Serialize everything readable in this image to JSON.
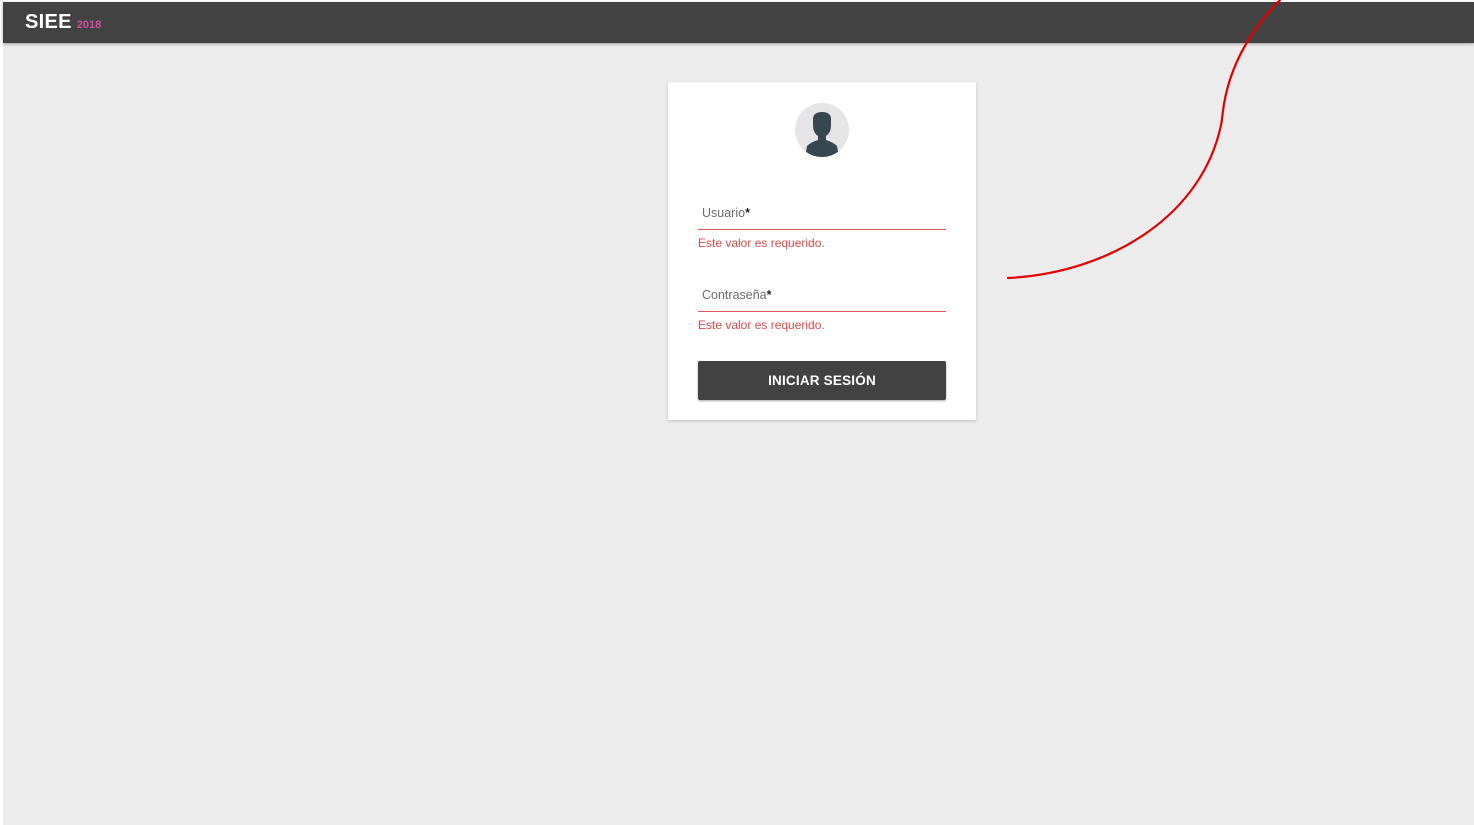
{
  "topbar": {
    "brand_name": "SIEE",
    "brand_year": "2018",
    "brand_year_color": "#d24ea6",
    "background": "#424242"
  },
  "login": {
    "avatar_icon": "user-silhouette-icon",
    "username": {
      "label": "Usuario",
      "required_mark": "*",
      "value": "",
      "error": "Este valor es requerido."
    },
    "password": {
      "label": "Contraseña",
      "required_mark": "*",
      "value": "",
      "error": "Este valor es requerido."
    },
    "submit_label": "INICIAR SESIÓN"
  },
  "colors": {
    "error": "#e04848",
    "page_background": "#ececec",
    "annotation_stroke": "#e00000"
  }
}
